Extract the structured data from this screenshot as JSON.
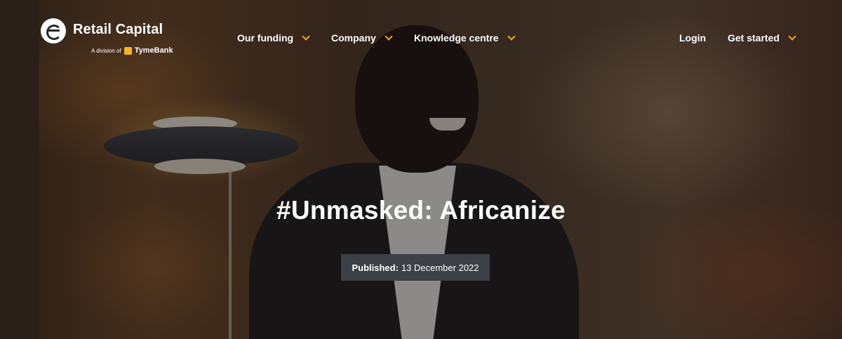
{
  "brand": {
    "name": "Retail Capital",
    "tagline_prefix": "A division of",
    "parent": "TymeBank",
    "accent": "#f5a623",
    "parent_accent": "#f5b323"
  },
  "nav": {
    "items": [
      {
        "label": "Our funding",
        "has_dropdown": true
      },
      {
        "label": "Company",
        "has_dropdown": true
      },
      {
        "label": "Knowledge centre",
        "has_dropdown": true
      }
    ],
    "login_label": "Login",
    "get_started_label": "Get started"
  },
  "hero": {
    "title": "#Unmasked: Africanize",
    "published_label": "Published:",
    "published_date": "13 December 2022",
    "badge_color": "#3c4047"
  }
}
